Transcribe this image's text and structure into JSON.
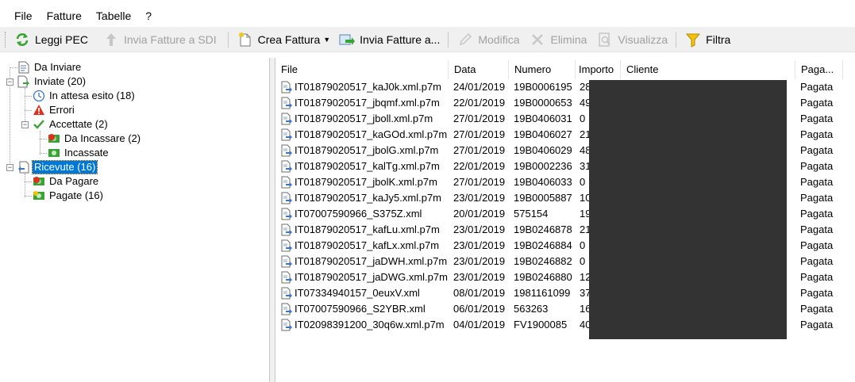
{
  "menu": {
    "items": [
      "File",
      "Fatture",
      "Tabelle",
      "?"
    ]
  },
  "toolbar": {
    "leggi_pec": "Leggi PEC",
    "invia_sdi": "Invia Fatture a SDI",
    "crea_fattura": "Crea Fattura",
    "invia_fatture": "Invia Fatture a...",
    "modifica": "Modifica",
    "elimina": "Elimina",
    "visualizza": "Visualizza",
    "filtra": "Filtra"
  },
  "tree": {
    "da_inviare": "Da Inviare",
    "inviate": "Inviate (20)",
    "in_attesa": "In attesa esito (18)",
    "errori": "Errori",
    "accettate": "Accettate (2)",
    "da_incassare": "Da Incassare (2)",
    "incassate": "Incassate",
    "ricevute": "Ricevute (16)",
    "da_pagare": "Da Pagare",
    "pagate": "Pagate (16)"
  },
  "table": {
    "columns": {
      "file": "File",
      "data": "Data",
      "numero": "Numero",
      "importo": "Importo",
      "cliente": "Cliente",
      "pagamento": "Paga..."
    },
    "rows": [
      {
        "file": "IT01879020517_kaJ0k.xml.p7m",
        "data": "24/01/2019",
        "numero": "19B0006195",
        "importo": "28",
        "pagamento": "Pagata"
      },
      {
        "file": "IT01879020517_jbqmf.xml.p7m",
        "data": "22/01/2019",
        "numero": "19B0000653",
        "importo": "49",
        "pagamento": "Pagata"
      },
      {
        "file": "IT01879020517_jboll.xml.p7m",
        "data": "27/01/2019",
        "numero": "19B0406031",
        "importo": "0",
        "pagamento": "Pagata"
      },
      {
        "file": "IT01879020517_kaGOd.xml.p7m",
        "data": "27/01/2019",
        "numero": "19B0406027",
        "importo": "21",
        "pagamento": "Pagata"
      },
      {
        "file": "IT01879020517_jbolG.xml.p7m",
        "data": "27/01/2019",
        "numero": "19B0406029",
        "importo": "48",
        "pagamento": "Pagata"
      },
      {
        "file": "IT01879020517_kalTg.xml.p7m",
        "data": "22/01/2019",
        "numero": "19B0002236",
        "importo": "31",
        "pagamento": "Pagata"
      },
      {
        "file": "IT01879020517_jbolK.xml.p7m",
        "data": "27/01/2019",
        "numero": "19B0406033",
        "importo": "0",
        "pagamento": "Pagata"
      },
      {
        "file": "IT01879020517_kaJy5.xml.p7m",
        "data": "23/01/2019",
        "numero": "19B0005887",
        "importo": "10",
        "pagamento": "Pagata"
      },
      {
        "file": "IT07007590966_S375Z.xml",
        "data": "20/01/2019",
        "numero": "575154",
        "importo": "19",
        "pagamento": "Pagata"
      },
      {
        "file": "IT01879020517_kafLu.xml.p7m",
        "data": "23/01/2019",
        "numero": "19B0246878",
        "importo": "21",
        "pagamento": "Pagata"
      },
      {
        "file": "IT01879020517_kafLx.xml.p7m",
        "data": "23/01/2019",
        "numero": "19B0246884",
        "importo": "0",
        "pagamento": "Pagata"
      },
      {
        "file": "IT01879020517_jaDWH.xml.p7m",
        "data": "23/01/2019",
        "numero": "19B0246882",
        "importo": "0",
        "pagamento": "Pagata"
      },
      {
        "file": "IT01879020517_jaDWG.xml.p7m",
        "data": "23/01/2019",
        "numero": "19B0246880",
        "importo": "12",
        "pagamento": "Pagata"
      },
      {
        "file": "IT07334940157_0euxV.xml",
        "data": "08/01/2019",
        "numero": "1981161099",
        "importo": "37",
        "pagamento": "Pagata"
      },
      {
        "file": "IT07007590966_S2YBR.xml",
        "data": "06/01/2019",
        "numero": "563263",
        "importo": "16",
        "pagamento": "Pagata"
      },
      {
        "file": "IT02098391200_30q6w.xml.p7m",
        "data": "04/01/2019",
        "numero": "FV1900085",
        "importo": "40",
        "pagamento": "Pagata"
      }
    ]
  },
  "colors": {
    "selection": "#0078d7",
    "redaction": "#333333",
    "toolbar_bg": "#f0f0f0"
  }
}
